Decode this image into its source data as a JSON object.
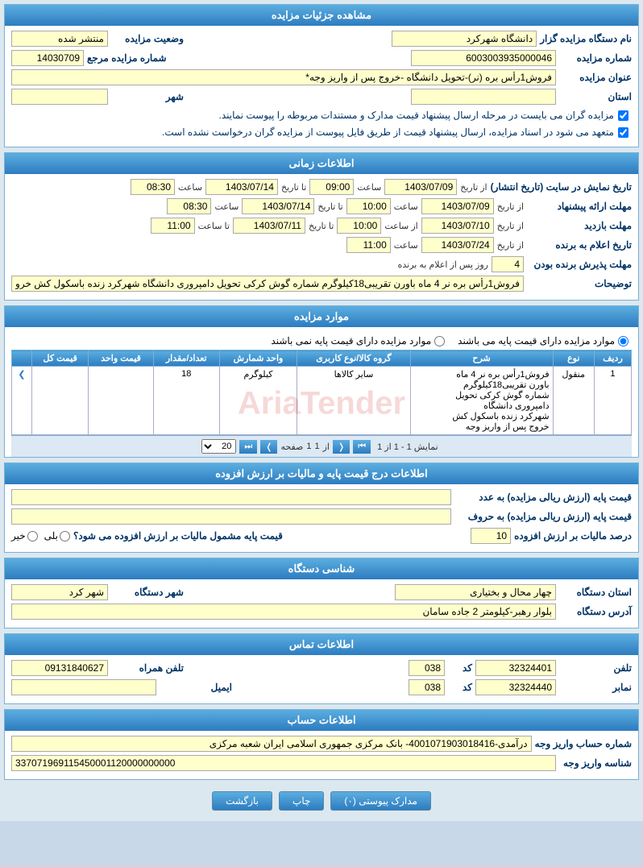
{
  "page": {
    "title": "مشاهده جزئیات مزایده"
  },
  "section_details": {
    "header": "مشاهده جزئیات مزایده",
    "fields": {
      "naam_dastgah_label": "نام دستگاه مزایده گزار",
      "naam_dastgah_value": "دانشگاه شهرکرد",
      "vaziat_label": "وضعیت مزایده",
      "vaziat_value": "منتشر شده",
      "shomare_mzayede_label": "شماره مزایده",
      "shomare_mzayede_value": "6003003935000046",
      "shomare_maraje_label": "شماره مزایده مرجع",
      "shomare_maraje_value": "14030709",
      "onvan_label": "عنوان مزایده",
      "onvan_value": "فروش1رأس بره (نر)-تحویل دانشگاه -خروج پس از واریز وجه*",
      "ostan_label": "استان",
      "ostan_value": "",
      "shahr_label": "شهر",
      "shahr_value": ""
    },
    "checkboxes": [
      "مزایده گران می بایست در مرحله ارسال پیشنهاد قیمت مدارک و مستندات مربوطه را پیوست نمایند.",
      "متعهد می شود در اسناد مزایده، ارسال پیشنهاد قیمت از طریق فایل پیوست از مزایده گران درخواست نشده است."
    ]
  },
  "section_time": {
    "header": "اطلاعات زمانی",
    "rows": [
      {
        "label": "تاریخ نمایش در سایت (تاریخ انتشار)",
        "from_date": "1403/07/09",
        "from_time": "09:00",
        "to_date": "1403/07/14",
        "to_time": "08:30"
      },
      {
        "label": "مهلت ارائه پیشنهاد",
        "from_date": "1403/07/09",
        "from_time": "10:00",
        "to_date": "1403/07/14",
        "to_time": "08:30"
      },
      {
        "label": "مهلت بازدید",
        "from_date": "1403/07/10",
        "from_time": "10:00",
        "to_date": "1403/07/11",
        "to_time": "11:00"
      },
      {
        "label": "تاریخ اعلام به برنده",
        "from_date": "1403/07/24",
        "from_time": "11:00",
        "to_date": "",
        "to_time": ""
      }
    ],
    "mohlat_pardesh": {
      "label": "مهلت پذیرش برنده بودن",
      "value": "4",
      "suffix": "روز پس از اعلام به برنده"
    },
    "tozi_label": "توضیحات",
    "tozi_value": "فروش1رأس بره نر 4 ماه باورن تقریبی18کیلوگرم شماره گوش کرکی تحویل دامپروری دانشگاه شهرکرد زنده باسکول کش خروج پس از واریز وجه"
  },
  "section_moavared": {
    "header": "موارد مزایده",
    "option1": "موارد مزایده دارای قیمت پایه می باشند",
    "option2": "موارد مزایده دارای قیمت پایه نمی باشند",
    "table": {
      "columns": [
        "ردیف",
        "نوع",
        "شرح",
        "گروه کالا/نوع کاربری",
        "واحد شمارش",
        "تعداد/مقدار",
        "قیمت واحد",
        "قیمت کل",
        ""
      ],
      "rows": [
        {
          "radif": "1",
          "no3": "منقول",
          "sharh": "فروش1رأس بره نر 4 ماه باورن تقریبی18کیلوگرم شماره گوش کرکی تحویل دامپروری دانشگاه شهرکرد زنده باسکول کش خروج پس از واریز وجه",
          "goroh": "سایر کالاها",
          "vahed": "کیلوگرم",
          "tedad": "18",
          "gheymat_vahed": "",
          "gheymat_kol": "",
          "action": ">"
        }
      ]
    },
    "pagination": {
      "show_count": "20",
      "current_page": "1",
      "total_pages": "1",
      "showing": "نمایش 1 - 1 از 1",
      "page_label": "صفحه"
    }
  },
  "section_price": {
    "header": "اطلاعات درج قیمت پایه و مالیات بر ارزش افزوده",
    "fields": {
      "gheymat_paye_adad_label": "قیمت پایه (ارزش ریالی مزایده) به عدد",
      "gheymat_paye_adad_value": "",
      "gheymat_paye_horof_label": "قیمت پایه (ارزش ریالی مزایده) به حروف",
      "gheymat_paye_horof_value": "",
      "mashmo_label": "قیمت پایه مشمول مالیات بر ارزش افزوده می شود؟",
      "bali": "بلی",
      "kheyr": "خیر",
      "darsad_label": "درصد مالیات بر ارزش افزوده",
      "darsad_value": "10"
    }
  },
  "section_dastgah": {
    "header": "شناسی دستگاه",
    "fields": {
      "ostan_label": "استان دستگاه",
      "ostan_value": "چهار محال و بختیاری",
      "shahr_label": "شهر دستگاه",
      "shahr_value": "شهر کرد",
      "address_label": "آدرس دستگاه",
      "address_value": "بلوار رهبر-کیلومتر 2 جاده سامان"
    }
  },
  "section_contact": {
    "header": "اطلاعات تماس",
    "fields": {
      "telefon_label": "تلفن",
      "telefon_value": "32324401",
      "telefon_code": "038",
      "mobile_label": "تلفن همراه",
      "mobile_value": "09131840627",
      "namabar_label": "نمابر",
      "namabar_value": "32324440",
      "namabar_code": "038",
      "email_label": "ایمیل",
      "email_value": ""
    }
  },
  "section_account": {
    "header": "اطلاعات حساب",
    "fields": {
      "hesab_label": "شماره حساب واریز وجه",
      "hesab_value": "درآمدی-4001071903018416- بانک مرکزی جمهوری اسلامی ایران شعبه مرکزی",
      "shenase_label": "شناسه واریز وجه",
      "shenase_value": "337071969115450001120000000000"
    }
  },
  "buttons": {
    "madarek": "مدارک پیوستی (۰)",
    "chap": "چاپ",
    "bazgasht": "بازگشت"
  }
}
